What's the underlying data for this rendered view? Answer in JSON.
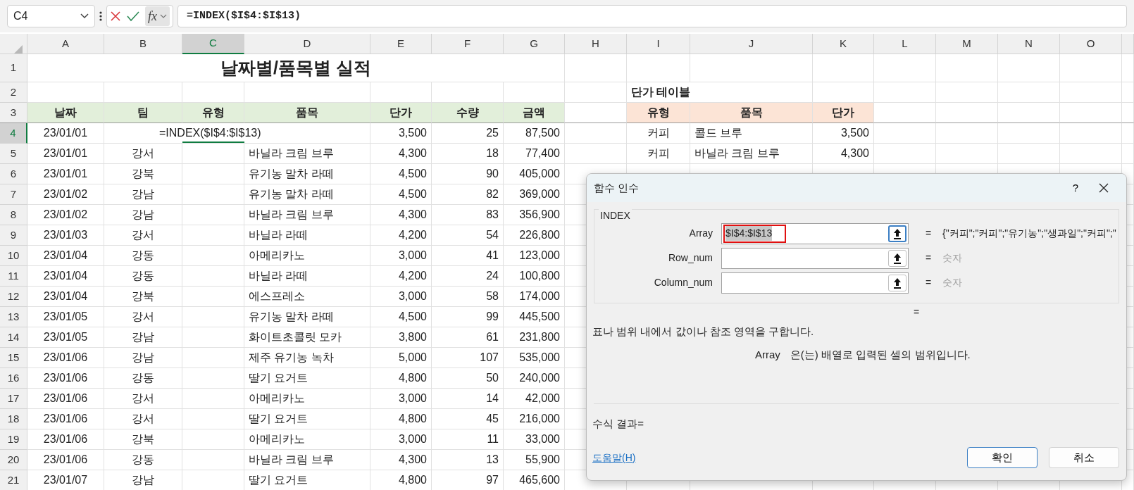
{
  "formula_bar": {
    "name_box": "C4",
    "fx_label": "fx",
    "formula": "=INDEX($I$4:$I$13)"
  },
  "column_headers": [
    {
      "label": "A",
      "selected": false
    },
    {
      "label": "B",
      "selected": false
    },
    {
      "label": "C",
      "selected": true
    },
    {
      "label": "D",
      "selected": false
    },
    {
      "label": "E",
      "selected": false
    },
    {
      "label": "F",
      "selected": false
    },
    {
      "label": "G",
      "selected": false
    },
    {
      "label": "H",
      "selected": false
    },
    {
      "label": "I",
      "selected": false
    },
    {
      "label": "J",
      "selected": false
    },
    {
      "label": "K",
      "selected": false
    },
    {
      "label": "L",
      "selected": false
    },
    {
      "label": "M",
      "selected": false
    },
    {
      "label": "N",
      "selected": false
    },
    {
      "label": "O",
      "selected": false
    }
  ],
  "row_headers": [
    {
      "label": "1",
      "selected": false
    },
    {
      "label": "2",
      "selected": false
    },
    {
      "label": "3",
      "selected": false
    },
    {
      "label": "4",
      "selected": true
    },
    {
      "label": "5",
      "selected": false
    },
    {
      "label": "6",
      "selected": false
    },
    {
      "label": "7",
      "selected": false
    },
    {
      "label": "8",
      "selected": false
    },
    {
      "label": "9",
      "selected": false
    },
    {
      "label": "10",
      "selected": false
    },
    {
      "label": "11",
      "selected": false
    },
    {
      "label": "12",
      "selected": false
    },
    {
      "label": "13",
      "selected": false
    },
    {
      "label": "14",
      "selected": false
    },
    {
      "label": "15",
      "selected": false
    },
    {
      "label": "16",
      "selected": false
    },
    {
      "label": "17",
      "selected": false
    },
    {
      "label": "18",
      "selected": false
    },
    {
      "label": "19",
      "selected": false
    },
    {
      "label": "20",
      "selected": false
    },
    {
      "label": "21",
      "selected": false
    }
  ],
  "sheet_title": "날짜별/품목별 실적",
  "sales_table": {
    "columns": [
      "날짜",
      "팀",
      "유형",
      "품목",
      "단가",
      "수량",
      "금액"
    ],
    "rows": [
      {
        "date": "23/01/01",
        "type": "=INDEX($I$4:$I$13)",
        "editing": true,
        "price": "3,500",
        "qty": "25",
        "amount": "87,500"
      },
      {
        "date": "23/01/01",
        "team": "강서",
        "item": "바닐라 크림 브루",
        "price": "4,300",
        "qty": "18",
        "amount": "77,400"
      },
      {
        "date": "23/01/01",
        "team": "강북",
        "item": "유기농 말차 라떼",
        "price": "4,500",
        "qty": "90",
        "amount": "405,000"
      },
      {
        "date": "23/01/02",
        "team": "강남",
        "item": "유기농 말차 라떼",
        "price": "4,500",
        "qty": "82",
        "amount": "369,000"
      },
      {
        "date": "23/01/02",
        "team": "강남",
        "item": "바닐라 크림 브루",
        "price": "4,300",
        "qty": "83",
        "amount": "356,900"
      },
      {
        "date": "23/01/03",
        "team": "강서",
        "item": "바닐라 라떼",
        "price": "4,200",
        "qty": "54",
        "amount": "226,800"
      },
      {
        "date": "23/01/04",
        "team": "강동",
        "item": "아메리카노",
        "price": "3,000",
        "qty": "41",
        "amount": "123,000"
      },
      {
        "date": "23/01/04",
        "team": "강동",
        "item": "바닐라 라떼",
        "price": "4,200",
        "qty": "24",
        "amount": "100,800"
      },
      {
        "date": "23/01/04",
        "team": "강북",
        "item": "에스프레소",
        "price": "3,000",
        "qty": "58",
        "amount": "174,000"
      },
      {
        "date": "23/01/05",
        "team": "강서",
        "item": "유기농 말차 라떼",
        "price": "4,500",
        "qty": "99",
        "amount": "445,500"
      },
      {
        "date": "23/01/05",
        "team": "강남",
        "item": "화이트초콜릿 모카",
        "price": "3,800",
        "qty": "61",
        "amount": "231,800"
      },
      {
        "date": "23/01/06",
        "team": "강남",
        "item": "제주 유기농 녹차",
        "price": "5,000",
        "qty": "107",
        "amount": "535,000"
      },
      {
        "date": "23/01/06",
        "team": "강동",
        "item": "딸기 요거트",
        "price": "4,800",
        "qty": "50",
        "amount": "240,000"
      },
      {
        "date": "23/01/06",
        "team": "강서",
        "item": "아메리카노",
        "price": "3,000",
        "qty": "14",
        "amount": "42,000"
      },
      {
        "date": "23/01/06",
        "team": "강서",
        "item": "딸기 요거트",
        "price": "4,800",
        "qty": "45",
        "amount": "216,000"
      },
      {
        "date": "23/01/06",
        "team": "강북",
        "item": "아메리카노",
        "price": "3,000",
        "qty": "11",
        "amount": "33,000"
      },
      {
        "date": "23/01/06",
        "team": "강동",
        "item": "바닐라 크림 브루",
        "price": "4,300",
        "qty": "13",
        "amount": "55,900"
      },
      {
        "date": "23/01/07",
        "team": "강남",
        "item": "딸기 요거트",
        "price": "4,800",
        "qty": "97",
        "amount": "465,600"
      }
    ]
  },
  "price_table": {
    "title": "단가 테이블",
    "columns": [
      "유형",
      "품목",
      "단가"
    ],
    "rows": [
      {
        "type": "커피",
        "item": "콜드 브루",
        "price": "3,500"
      },
      {
        "type": "커피",
        "item": "바닐라 크림 브루",
        "price": "4,300"
      }
    ]
  },
  "dialog": {
    "title": "함수 인수",
    "help": "?",
    "group": "INDEX",
    "arguments": [
      {
        "label": "Array",
        "value": "$I$4:$I$13",
        "focused": true,
        "sign": "=",
        "result": "{\"커피\";\"커피\";\"유기농\";\"생과일\";\"커피\";\"",
        "muted": false
      },
      {
        "label": "Row_num",
        "focused": false,
        "sign": "=",
        "result": "숫자",
        "muted": true
      },
      {
        "label": "Column_num",
        "focused": false,
        "sign": "=",
        "result": "숫자",
        "muted": true
      }
    ],
    "function_result": "=",
    "description": "표나 범위 내에서 값이나 참조 영역을 구합니다.",
    "argument_name": "Array",
    "argument_description": "은(는) 배열로 입력된 셀의 범위입니다.",
    "formula_result": "수식 결과=",
    "help_link": "도움말(H)",
    "buttons": [
      {
        "label": "확인",
        "default": true
      },
      {
        "label": "취소",
        "default": false
      }
    ]
  }
}
